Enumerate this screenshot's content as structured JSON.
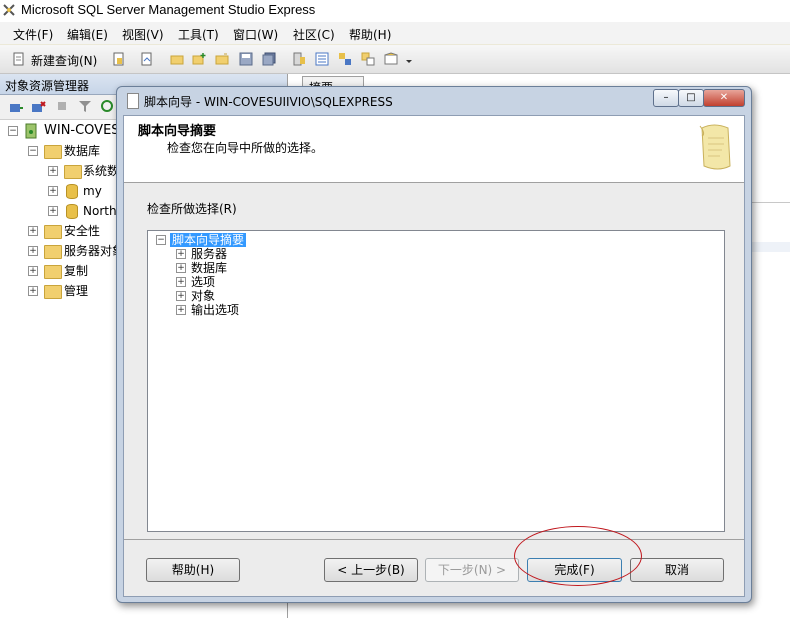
{
  "app": {
    "title": "Microsoft SQL Server Management Studio Express"
  },
  "menu": [
    "文件(F)",
    "编辑(E)",
    "视图(V)",
    "工具(T)",
    "窗口(W)",
    "社区(C)",
    "帮助(H)"
  ],
  "toolbar": {
    "new_query": "新建查询(N)"
  },
  "object_explorer": {
    "title": "对象资源管理器",
    "nodes": [
      "WIN-COVES",
      "数据库",
      "系统数",
      "my",
      "North",
      "安全性",
      "服务器对象",
      "复制",
      "管理"
    ]
  },
  "right_tab": "摘要",
  "dialog": {
    "title": "脚本向导 - WIN-COVESUIIVIO\\SQLEXPRESS",
    "heading": "脚本向导摘要",
    "subheading": "检查您在向导中所做的选择。",
    "review_label": "检查所做选择(R)",
    "tree": {
      "root": "脚本向导摘要",
      "children": [
        "服务器",
        "数据库",
        "选项",
        "对象",
        "输出选项"
      ]
    },
    "buttons": {
      "help": "帮助(H)",
      "back": "< 上一步(B)",
      "next": "下一步(N) >",
      "finish": "完成(F)",
      "cancel": "取消"
    }
  }
}
